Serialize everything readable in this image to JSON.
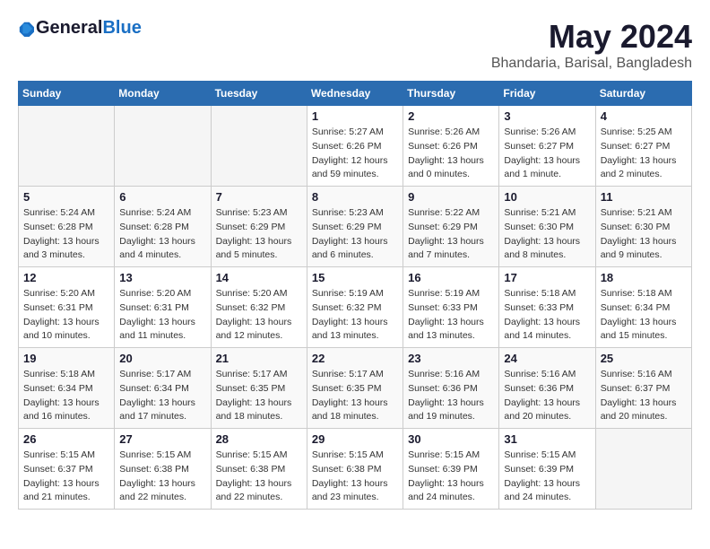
{
  "header": {
    "logo_general": "General",
    "logo_blue": "Blue",
    "month_year": "May 2024",
    "location": "Bhandaria, Barisal, Bangladesh"
  },
  "days_of_week": [
    "Sunday",
    "Monday",
    "Tuesday",
    "Wednesday",
    "Thursday",
    "Friday",
    "Saturday"
  ],
  "weeks": [
    [
      {
        "day": "",
        "info": ""
      },
      {
        "day": "",
        "info": ""
      },
      {
        "day": "",
        "info": ""
      },
      {
        "day": "1",
        "info": "Sunrise: 5:27 AM\nSunset: 6:26 PM\nDaylight: 12 hours and 59 minutes."
      },
      {
        "day": "2",
        "info": "Sunrise: 5:26 AM\nSunset: 6:26 PM\nDaylight: 13 hours and 0 minutes."
      },
      {
        "day": "3",
        "info": "Sunrise: 5:26 AM\nSunset: 6:27 PM\nDaylight: 13 hours and 1 minute."
      },
      {
        "day": "4",
        "info": "Sunrise: 5:25 AM\nSunset: 6:27 PM\nDaylight: 13 hours and 2 minutes."
      }
    ],
    [
      {
        "day": "5",
        "info": "Sunrise: 5:24 AM\nSunset: 6:28 PM\nDaylight: 13 hours and 3 minutes."
      },
      {
        "day": "6",
        "info": "Sunrise: 5:24 AM\nSunset: 6:28 PM\nDaylight: 13 hours and 4 minutes."
      },
      {
        "day": "7",
        "info": "Sunrise: 5:23 AM\nSunset: 6:29 PM\nDaylight: 13 hours and 5 minutes."
      },
      {
        "day": "8",
        "info": "Sunrise: 5:23 AM\nSunset: 6:29 PM\nDaylight: 13 hours and 6 minutes."
      },
      {
        "day": "9",
        "info": "Sunrise: 5:22 AM\nSunset: 6:29 PM\nDaylight: 13 hours and 7 minutes."
      },
      {
        "day": "10",
        "info": "Sunrise: 5:21 AM\nSunset: 6:30 PM\nDaylight: 13 hours and 8 minutes."
      },
      {
        "day": "11",
        "info": "Sunrise: 5:21 AM\nSunset: 6:30 PM\nDaylight: 13 hours and 9 minutes."
      }
    ],
    [
      {
        "day": "12",
        "info": "Sunrise: 5:20 AM\nSunset: 6:31 PM\nDaylight: 13 hours and 10 minutes."
      },
      {
        "day": "13",
        "info": "Sunrise: 5:20 AM\nSunset: 6:31 PM\nDaylight: 13 hours and 11 minutes."
      },
      {
        "day": "14",
        "info": "Sunrise: 5:20 AM\nSunset: 6:32 PM\nDaylight: 13 hours and 12 minutes."
      },
      {
        "day": "15",
        "info": "Sunrise: 5:19 AM\nSunset: 6:32 PM\nDaylight: 13 hours and 13 minutes."
      },
      {
        "day": "16",
        "info": "Sunrise: 5:19 AM\nSunset: 6:33 PM\nDaylight: 13 hours and 13 minutes."
      },
      {
        "day": "17",
        "info": "Sunrise: 5:18 AM\nSunset: 6:33 PM\nDaylight: 13 hours and 14 minutes."
      },
      {
        "day": "18",
        "info": "Sunrise: 5:18 AM\nSunset: 6:34 PM\nDaylight: 13 hours and 15 minutes."
      }
    ],
    [
      {
        "day": "19",
        "info": "Sunrise: 5:18 AM\nSunset: 6:34 PM\nDaylight: 13 hours and 16 minutes."
      },
      {
        "day": "20",
        "info": "Sunrise: 5:17 AM\nSunset: 6:34 PM\nDaylight: 13 hours and 17 minutes."
      },
      {
        "day": "21",
        "info": "Sunrise: 5:17 AM\nSunset: 6:35 PM\nDaylight: 13 hours and 18 minutes."
      },
      {
        "day": "22",
        "info": "Sunrise: 5:17 AM\nSunset: 6:35 PM\nDaylight: 13 hours and 18 minutes."
      },
      {
        "day": "23",
        "info": "Sunrise: 5:16 AM\nSunset: 6:36 PM\nDaylight: 13 hours and 19 minutes."
      },
      {
        "day": "24",
        "info": "Sunrise: 5:16 AM\nSunset: 6:36 PM\nDaylight: 13 hours and 20 minutes."
      },
      {
        "day": "25",
        "info": "Sunrise: 5:16 AM\nSunset: 6:37 PM\nDaylight: 13 hours and 20 minutes."
      }
    ],
    [
      {
        "day": "26",
        "info": "Sunrise: 5:15 AM\nSunset: 6:37 PM\nDaylight: 13 hours and 21 minutes."
      },
      {
        "day": "27",
        "info": "Sunrise: 5:15 AM\nSunset: 6:38 PM\nDaylight: 13 hours and 22 minutes."
      },
      {
        "day": "28",
        "info": "Sunrise: 5:15 AM\nSunset: 6:38 PM\nDaylight: 13 hours and 22 minutes."
      },
      {
        "day": "29",
        "info": "Sunrise: 5:15 AM\nSunset: 6:38 PM\nDaylight: 13 hours and 23 minutes."
      },
      {
        "day": "30",
        "info": "Sunrise: 5:15 AM\nSunset: 6:39 PM\nDaylight: 13 hours and 24 minutes."
      },
      {
        "day": "31",
        "info": "Sunrise: 5:15 AM\nSunset: 6:39 PM\nDaylight: 13 hours and 24 minutes."
      },
      {
        "day": "",
        "info": ""
      }
    ]
  ]
}
